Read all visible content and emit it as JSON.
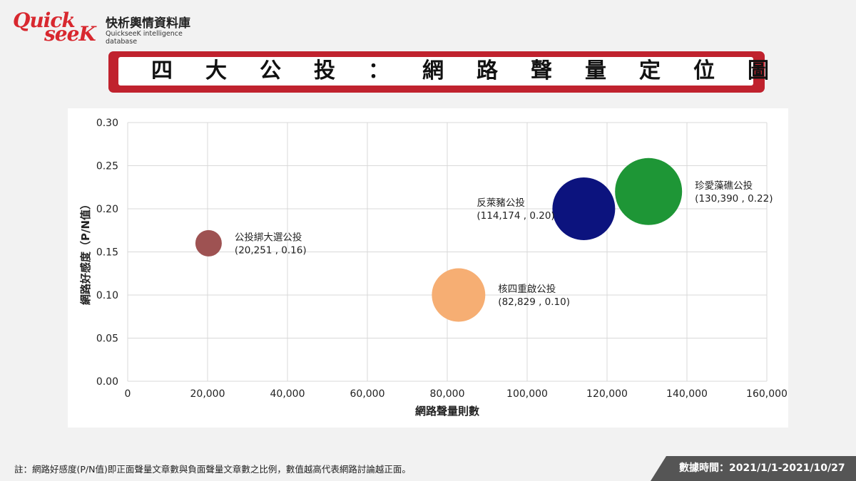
{
  "logo": {
    "word_quick": "Quick",
    "word_seek": "seeK",
    "name_zh": "快析輿情資料庫",
    "name_en": "QuickseeK intelligence database",
    "color": "#d8282f"
  },
  "banner": {
    "title": "四大公投：網路聲量定位圖",
    "color": "#c0222e"
  },
  "chart_data": {
    "type": "bubble",
    "xlabel": "網路聲量則數",
    "ylabel": "網路好感度（P/N值）",
    "xlim": [
      0,
      160000
    ],
    "ylim": [
      0,
      0.3
    ],
    "x_ticks": [
      "0",
      "20,000",
      "40,000",
      "60,000",
      "80,000",
      "100,000",
      "120,000",
      "140,000",
      "160,000"
    ],
    "y_ticks": [
      "0.00",
      "0.05",
      "0.10",
      "0.15",
      "0.20",
      "0.25",
      "0.30"
    ],
    "grid": true,
    "points": [
      {
        "name": "公投綁大選公投",
        "x": 20251,
        "y": 0.16,
        "value_label": "(20,251 , 0.16)",
        "color": "#9e5252"
      },
      {
        "name": "核四重啟公投",
        "x": 82829,
        "y": 0.1,
        "value_label": "(82,829 , 0.10)",
        "color": "#f6ae73"
      },
      {
        "name": "反萊豬公投",
        "x": 114174,
        "y": 0.2,
        "value_label": "(114,174 , 0.20)",
        "color": "#0c137e"
      },
      {
        "name": "珍愛藻礁公投",
        "x": 130390,
        "y": 0.22,
        "value_label": "(130,390 , 0.22)",
        "color": "#1e9636"
      }
    ]
  },
  "footer": {
    "note": "註：網路好感度(P/N值)即正面聲量文章數與負面聲量文章數之比例，數值越高代表網路討論越正面。",
    "period": "數據時間：2021/1/1-2021/10/27"
  }
}
